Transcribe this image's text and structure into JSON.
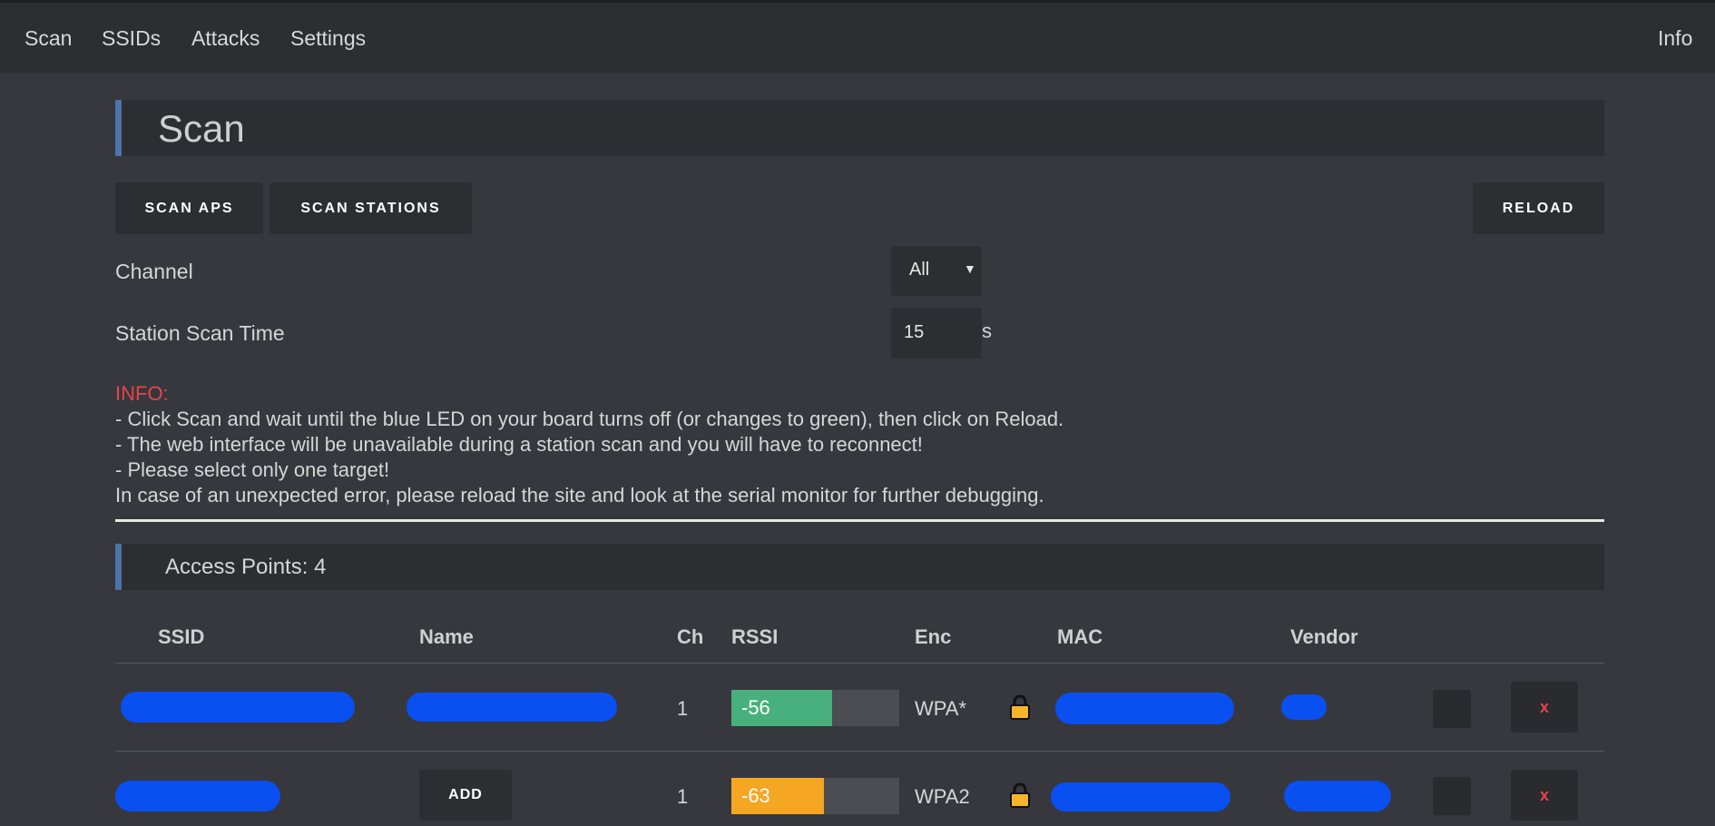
{
  "nav": {
    "items": [
      "Scan",
      "SSIDs",
      "Attacks",
      "Settings"
    ],
    "info": "Info"
  },
  "page_title": "Scan",
  "buttons": {
    "scan_aps": "SCAN APS",
    "scan_stations": "SCAN STATIONS",
    "reload": "RELOAD"
  },
  "channel": {
    "label": "Channel",
    "selected": "All"
  },
  "station_scan_time": {
    "label": "Station Scan Time",
    "value": "15",
    "unit": "s"
  },
  "info": {
    "heading": "INFO:",
    "lines": [
      "- Click Scan and wait until the blue LED on your board turns off (or changes to green), then click on Reload.",
      "- The web interface will be unavailable during a station scan and you will have to reconnect!",
      "- Please select only one target!",
      "In case of an unexpected error, please reload the site and look at the serial monitor for further debugging."
    ]
  },
  "access_points": {
    "heading": "Access Points: 4",
    "columns": [
      "SSID",
      "Name",
      "Ch",
      "RSSI",
      "Enc",
      "MAC",
      "Vendor"
    ],
    "rows": [
      {
        "ch": "1",
        "rssi": "-56",
        "rssi_level": 0.6,
        "rssi_color": "#48b07c",
        "enc": "WPA*",
        "delete": "x"
      },
      {
        "ch": "1",
        "rssi": "-63",
        "rssi_level": 0.55,
        "rssi_color": "#f5a623",
        "enc": "WPA2",
        "name_button": "ADD",
        "delete": "x"
      }
    ]
  },
  "colors": {
    "accent": "#4d73a8",
    "info_red": "#e5444c",
    "redaction": "#0a4ff0"
  }
}
